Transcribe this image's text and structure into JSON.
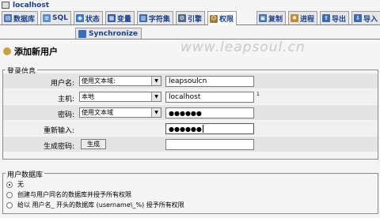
{
  "server": {
    "name": "localhost"
  },
  "tabs": [
    {
      "label": "数据库",
      "icon": "database-icon",
      "color": "#4a6fb5"
    },
    {
      "label": "SQL",
      "icon": "sql-icon",
      "color": "#5a8fd4"
    },
    {
      "label": "状态",
      "icon": "status-icon",
      "color": "#3a7bbf"
    },
    {
      "label": "变量",
      "icon": "variables-icon",
      "color": "#2f5fa8"
    },
    {
      "label": "字符集",
      "icon": "charset-icon",
      "color": "#3a6ab0"
    },
    {
      "label": "引擎",
      "icon": "engine-icon",
      "color": "#506a8a"
    },
    {
      "label": "权限",
      "icon": "privileges-icon",
      "color": "#a07a30",
      "active": true
    },
    {
      "label": "复制",
      "icon": "replication-icon",
      "color": "#3b6fb8"
    },
    {
      "label": "进程",
      "icon": "process-icon",
      "color": "#c28b2b"
    },
    {
      "label": "导出",
      "icon": "export-icon",
      "color": "#3a6ab0"
    },
    {
      "label": "导入",
      "icon": "import-icon",
      "color": "#3a6ab0"
    }
  ],
  "subtab": {
    "label": "Synchronize",
    "icon": "synchronize-icon"
  },
  "watermark": "www.leapsoul.cn",
  "page_title": "添加新用户",
  "login": {
    "legend": "登录信息",
    "username_label": "用户名:",
    "username_mode": "使用文本域:",
    "username_value": "leapsoulcn",
    "host_label": "主机:",
    "host_mode": "本地",
    "host_value": "localhost",
    "host_note": "1",
    "password_label": "密码:",
    "password_mode": "使用文本域",
    "password_value": "●●●●●●",
    "retype_label": "重新输入:",
    "retype_value": "●●●●●●",
    "generate_label": "生成密码:",
    "generate_button": "生成",
    "generated_value": ""
  },
  "userdb": {
    "legend": "用户数据库",
    "options": [
      {
        "label": "无",
        "selected": true
      },
      {
        "label": "创建与用户同名的数据库并授予所有权限",
        "selected": false
      },
      {
        "label": "给以 用户名_ 开头的数据库 (username\\_%) 授予所有权限",
        "selected": false
      }
    ]
  }
}
